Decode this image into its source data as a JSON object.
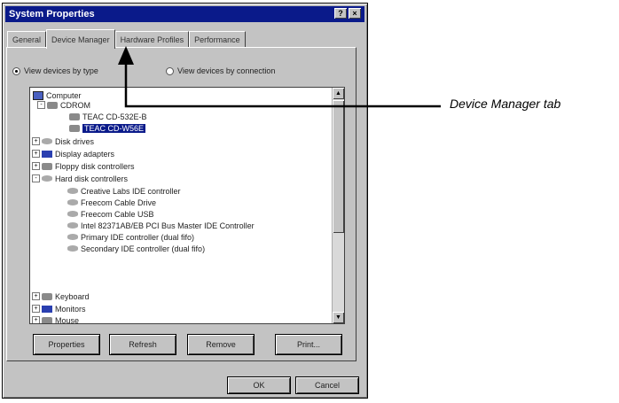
{
  "window": {
    "title": "System Properties",
    "help_btn": "?",
    "close_btn": "×"
  },
  "tabs": [
    {
      "label": "General",
      "active": false
    },
    {
      "label": "Device Manager",
      "active": true
    },
    {
      "label": "Hardware Profiles",
      "active": false
    },
    {
      "label": "Performance",
      "active": false
    }
  ],
  "view_options": {
    "by_type": "View devices by type",
    "by_connection": "View devices by connection",
    "selected": "by_type"
  },
  "tree": {
    "items": [
      {
        "label": "Computer",
        "icon": "computer-icon",
        "expander": ""
      },
      {
        "label": "CDROM",
        "icon": "cdrom-icon",
        "expander": "-"
      },
      {
        "label": "TEAC CD-532E-B",
        "icon": "cdrom-icon",
        "expander": ""
      },
      {
        "label": "TEAC CD-W56E",
        "icon": "cdrom-icon",
        "expander": "",
        "selected": true
      },
      {
        "label": "Disk drives",
        "icon": "disk-icon",
        "expander": "+"
      },
      {
        "label": "Display adapters",
        "icon": "display-icon",
        "expander": "+"
      },
      {
        "label": "Floppy disk controllers",
        "icon": "floppy-icon",
        "expander": "+"
      },
      {
        "label": "Hard disk controllers",
        "icon": "controller-icon",
        "expander": "-"
      },
      {
        "label": "Creative Labs IDE controller",
        "icon": "controller-icon",
        "expander": ""
      },
      {
        "label": "Freecom Cable Drive",
        "icon": "controller-icon",
        "expander": ""
      },
      {
        "label": "Freecom Cable USB",
        "icon": "controller-icon",
        "expander": ""
      },
      {
        "label": "Intel 82371AB/EB PCI Bus Master IDE Controller",
        "icon": "controller-icon",
        "expander": ""
      },
      {
        "label": "Primary IDE controller (dual fifo)",
        "icon": "controller-icon",
        "expander": ""
      },
      {
        "label": "Secondary IDE controller (dual fifo)",
        "icon": "controller-icon",
        "expander": ""
      },
      {
        "label": "Keyboard",
        "icon": "keyboard-icon",
        "expander": "+"
      },
      {
        "label": "Monitors",
        "icon": "monitor-icon",
        "expander": "+"
      },
      {
        "label": "Mouse",
        "icon": "mouse-icon",
        "expander": "+"
      }
    ]
  },
  "scroll": {
    "up": "▲",
    "down": "▼"
  },
  "action_buttons": {
    "properties": "Properties",
    "refresh": "Refresh",
    "remove": "Remove",
    "print": "Print..."
  },
  "dialog_buttons": {
    "ok": "OK",
    "cancel": "Cancel"
  },
  "callout": {
    "label": "Device Manager tab"
  }
}
